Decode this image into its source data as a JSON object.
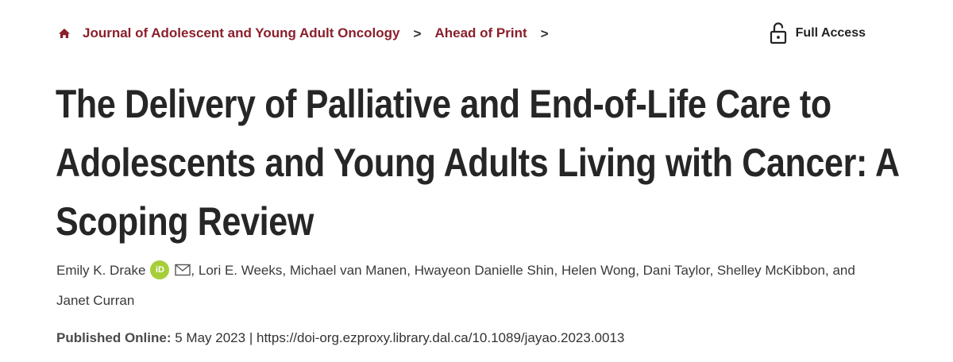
{
  "breadcrumb": {
    "journal": "Journal of Adolescent and Young Adult Oncology",
    "section": "Ahead of Print",
    "separator": ">"
  },
  "access": {
    "label": "Full Access",
    "icon": "unlocked-padlock-icon"
  },
  "article": {
    "title": "The Delivery of Palliative and End-of-Life Care to Adolescents and Young Adults Living with Cancer: A Scoping Review",
    "authors": [
      "Emily K. Drake",
      "Lori E. Weeks",
      "Michael van Manen",
      "Hwayeon Danielle Shin",
      "Helen Wong",
      "Dani Taylor",
      "Shelley McKibbon",
      "Janet Curran"
    ],
    "orcid_label": "iD",
    "conjunction": "and",
    "published_label": "Published Online:",
    "published_date": "5 May 2023",
    "pipe": "|",
    "doi": "https://doi-org.ezproxy.library.dal.ca/10.1089/jayao.2023.0013"
  },
  "colors": {
    "brand": "#8a1f2c",
    "orcid": "#a6ce39",
    "title": "#262626"
  }
}
